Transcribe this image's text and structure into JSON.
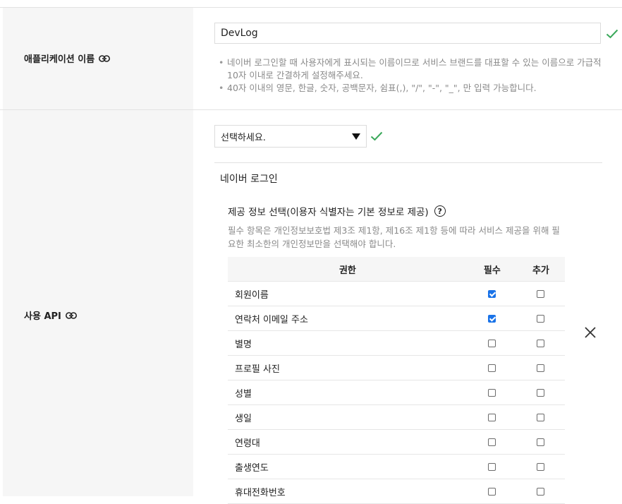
{
  "app_name_section": {
    "label": "애플리케이션 이름",
    "input_value": "DevLog",
    "notes": [
      "네이버 로그인할 때 사용자에게 표시되는 이름이므로 서비스 브랜드를 대표할 수 있는 이름으로 가급적 10자 이내로 간결하게 설정해주세요.",
      "40자 이내의 영문, 한글, 숫자, 공백문자, 쉼표(,), \"/\", \"-\", \"_\", 만 입력 가능합니다."
    ]
  },
  "api_section": {
    "label": "사용 API",
    "select_value": "선택하세요.",
    "api_title": "네이버 로그인",
    "info_title": "제공 정보 선택(이용자 식별자는 기본 정보로 제공)",
    "help_icon_glyph": "?",
    "info_desc": "필수 항목은 개인정보보호법 제3조 제1항, 제16조 제1항 등에 따라 서비스 제공을 위해 필요한 최소한의 개인정보만을 선택해야 합니다.",
    "table": {
      "headers": {
        "permission": "권한",
        "required": "필수",
        "additional": "추가"
      },
      "rows": [
        {
          "name": "회원이름",
          "required": true,
          "additional": false
        },
        {
          "name": "연락처 이메일 주소",
          "required": true,
          "additional": false
        },
        {
          "name": "별명",
          "required": false,
          "additional": false
        },
        {
          "name": "프로필 사진",
          "required": false,
          "additional": false
        },
        {
          "name": "성별",
          "required": false,
          "additional": false
        },
        {
          "name": "생일",
          "required": false,
          "additional": false
        },
        {
          "name": "연령대",
          "required": false,
          "additional": false
        },
        {
          "name": "출생연도",
          "required": false,
          "additional": false
        },
        {
          "name": "휴대전화번호",
          "required": false,
          "additional": false
        }
      ]
    }
  },
  "colors": {
    "check_green": "#3aa85a",
    "checkbox_blue": "#1a73e8",
    "label_bg": "#f6f6f6"
  }
}
